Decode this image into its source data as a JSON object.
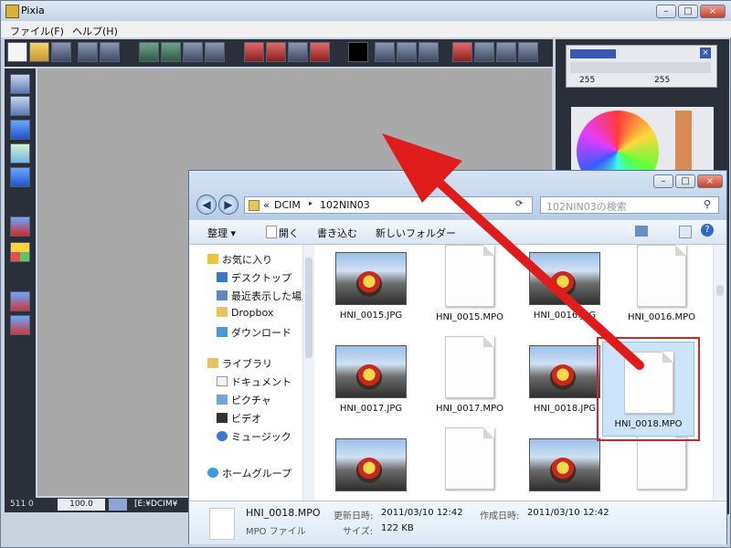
{
  "pixia": {
    "title": "Pixia",
    "menu": [
      "ファイル(F)",
      "ヘルプ(H)"
    ],
    "status": {
      "left": "511 0",
      "zoom": "100.0",
      "path": "[E:¥DCIM¥"
    },
    "color_panel": {
      "value1": "255",
      "value2": "255"
    },
    "caption_buttons": [
      "–",
      "□",
      "×"
    ]
  },
  "explorer": {
    "caption_buttons": [
      "–",
      "□",
      "×"
    ],
    "breadcrumb": [
      "DCIM",
      "102NIN03"
    ],
    "breadcrumb_prefix": "«",
    "search_placeholder": "102NIN03の検索",
    "commands": [
      "整理 ▾",
      "開く",
      "書き込む",
      "新しいフォルダー"
    ],
    "nav": [
      {
        "label": "お気に入り",
        "icon": "star-icon"
      },
      {
        "label": "デスクトップ",
        "icon": "desktop-icon"
      },
      {
        "label": "最近表示した場所",
        "icon": "recent-places-icon"
      },
      {
        "label": "Dropbox",
        "icon": "folder-icon"
      },
      {
        "label": "ダウンロード",
        "icon": "downloads-icon"
      },
      {
        "label": "ライブラリ",
        "icon": "library-icon"
      },
      {
        "label": "ドキュメント",
        "icon": "documents-icon"
      },
      {
        "label": "ピクチャ",
        "icon": "pictures-icon"
      },
      {
        "label": "ビデオ",
        "icon": "video-icon"
      },
      {
        "label": "ミュージック",
        "icon": "music-icon"
      },
      {
        "label": "ホームグループ",
        "icon": "homegroup-icon"
      }
    ],
    "files": [
      {
        "name": "HNI_0015.JPG",
        "kind": "photo"
      },
      {
        "name": "HNI_0015.MPO",
        "kind": "doc"
      },
      {
        "name": "HNI_0016.JPG",
        "kind": "photo"
      },
      {
        "name": "HNI_0016.MPO",
        "kind": "doc"
      },
      {
        "name": "HNI_0017.JPG",
        "kind": "photo"
      },
      {
        "name": "HNI_0017.MPO",
        "kind": "doc"
      },
      {
        "name": "HNI_0018.JPG",
        "kind": "photo"
      },
      {
        "name": "HNI_0018.MPO",
        "kind": "doc",
        "selected": true
      }
    ],
    "details": {
      "filename": "HNI_0018.MPO",
      "filetype": "MPO ファイル",
      "modified_label": "更新日時:",
      "modified": "2011/03/10 12:42",
      "created_label": "作成日時:",
      "created": "2011/03/10 12:42",
      "size_label": "サイズ:",
      "size": "122 KB"
    }
  },
  "annotation": {
    "arrow_color": "#e01b1b",
    "highlight_color": "#d32525"
  }
}
